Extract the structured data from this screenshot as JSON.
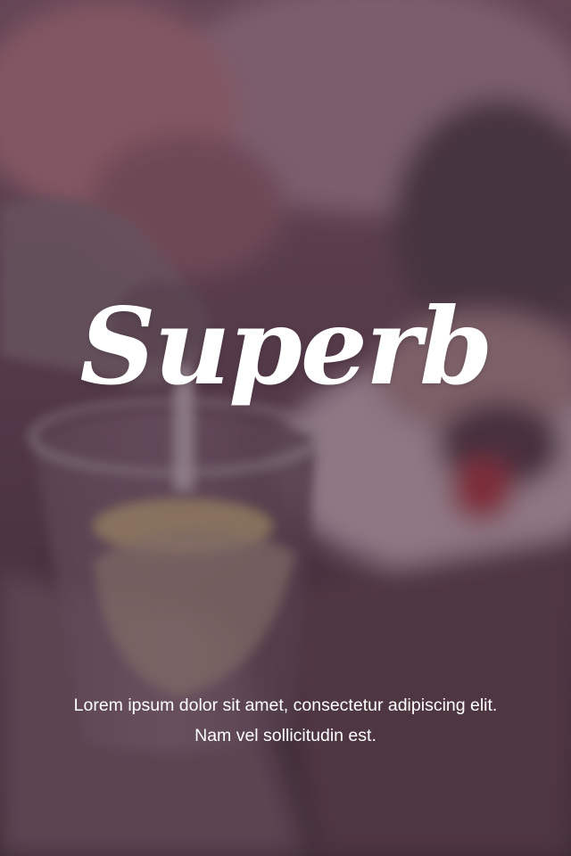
{
  "app": {
    "logo_text": "Superb",
    "tagline": "Lorem ipsum dolor sit amet, consectetur adipiscing elit. Nam vel sollicitudin est."
  },
  "background": {
    "icon": "restaurant-photo",
    "overlay_color": "#5a3a50"
  }
}
